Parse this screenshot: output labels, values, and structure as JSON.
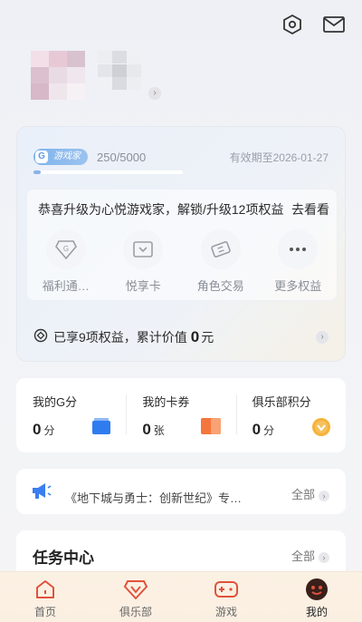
{
  "header": {
    "settings_icon": "hexagon-gear-icon",
    "mail_icon": "mail-icon"
  },
  "vip": {
    "badge_label": "游戏家",
    "badge_letter": "G",
    "progress_text": "250/5000",
    "progress_fraction": 0.05,
    "expire_text": "有效期至2026-01-27",
    "upgrade_message": "恭喜升级为心悦游戏家，解锁/升级12项权益",
    "see_label": "去看看",
    "benefits": [
      {
        "label": "福利通…",
        "icon": "gift-diamond-icon"
      },
      {
        "label": "悦享卡",
        "icon": "card-icon"
      },
      {
        "label": "角色交易",
        "icon": "ticket-icon"
      },
      {
        "label": "更多权益",
        "icon": "more-icon"
      }
    ],
    "summary_prefix": "已享9项权益，累计价值",
    "summary_value": "0",
    "summary_unit": "元"
  },
  "stats": [
    {
      "label": "我的G分",
      "value": "0",
      "unit": "分"
    },
    {
      "label": "我的卡券",
      "value": "0",
      "unit": "张"
    },
    {
      "label": "俱乐部积分",
      "value": "0",
      "unit": "分"
    }
  ],
  "news": {
    "text": "《地下城与勇士：创新世纪》专…",
    "all_label": "全部"
  },
  "tasks": {
    "title": "任务中心",
    "all_label": "全部"
  },
  "nav": [
    {
      "label": "首页",
      "icon": "home-icon"
    },
    {
      "label": "俱乐部",
      "icon": "club-diamond-icon"
    },
    {
      "label": "游戏",
      "icon": "gamepad-icon"
    },
    {
      "label": "我的",
      "icon": "profile-avatar-icon"
    }
  ],
  "colors": {
    "accent": "#e0533d",
    "vip_blue": "#8ab3e6",
    "nav_bg": "#fbf1e3"
  }
}
